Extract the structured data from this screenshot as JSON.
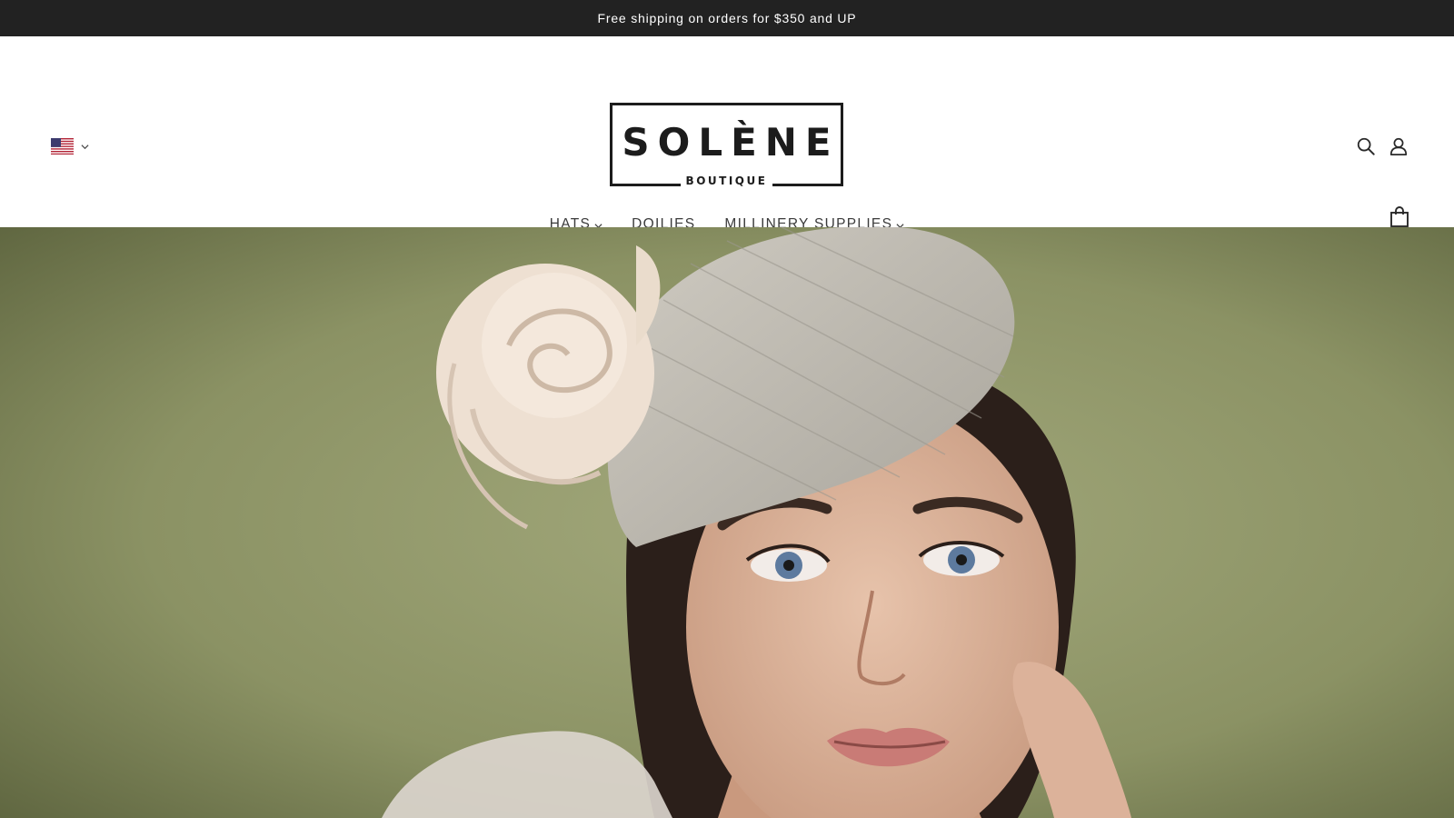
{
  "announcement": {
    "text": "Free shipping on orders for $350 and UP"
  },
  "header": {
    "locale": {
      "flag": "us-flag-icon",
      "selected": "US"
    },
    "logo": {
      "main": "SOLÈNE",
      "sub": "BOUTIQUE"
    },
    "nav": [
      {
        "label": "HATS",
        "has_dropdown": true
      },
      {
        "label": "DOILIES",
        "has_dropdown": false
      },
      {
        "label": "MILLINERY SUPPLIES",
        "has_dropdown": true
      }
    ],
    "icons": {
      "search": "search-icon",
      "account": "user-icon",
      "cart": "shopping-bag-icon"
    }
  },
  "hero": {
    "image": "woman-wearing-pillbox-fascinator-with-rose",
    "background_color": "#8d9466"
  },
  "colors": {
    "announcement_bg": "#222222",
    "text": "#3a3a3a",
    "logo": "#1c1c1c"
  }
}
